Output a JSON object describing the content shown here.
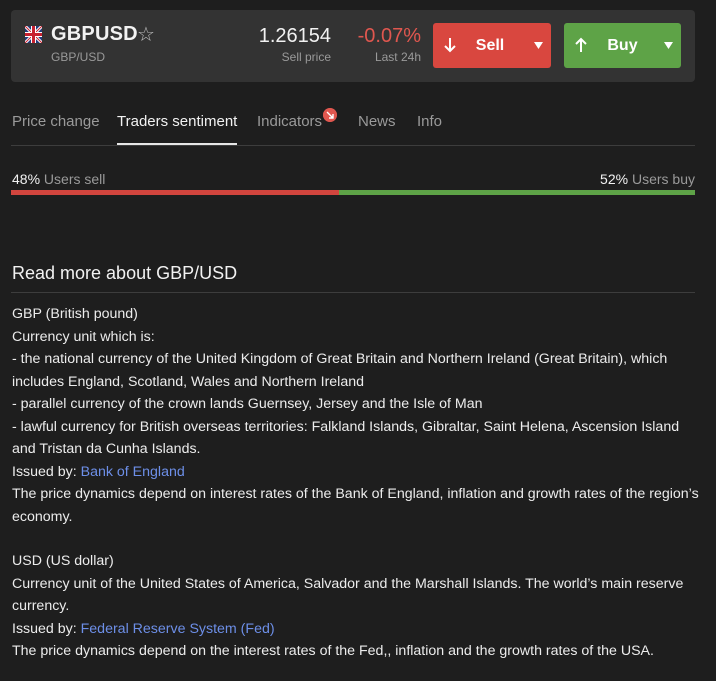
{
  "instrument": {
    "symbol": "GBPUSD",
    "pair": "GBP/USD",
    "flag_icon": "uk-flag-icon",
    "favorite_icon": "star-outline-icon"
  },
  "quote": {
    "price": "1.26154",
    "price_label": "Sell price",
    "change": "-0.07%",
    "change_label": "Last 24h"
  },
  "actions": {
    "sell_label": "Sell",
    "buy_label": "Buy"
  },
  "tabs": [
    {
      "label": "Price change",
      "active": false
    },
    {
      "label": "Traders sentiment",
      "active": true
    },
    {
      "label": "Indicators",
      "active": false,
      "badge": true
    },
    {
      "label": "News",
      "active": false
    },
    {
      "label": "Info",
      "active": false
    }
  ],
  "sentiment": {
    "sell_pct": 48,
    "buy_pct": 52,
    "sell_pct_text": "48%",
    "buy_pct_text": "52%",
    "sell_label": " Users sell",
    "buy_label": " Users buy"
  },
  "read_more": {
    "title": "Read more about GBP/USD",
    "gbp": {
      "heading": "GBP (British pound)",
      "intro": "Currency unit which is:",
      "point1": "- the national currency of the United Kingdom of Great Britain and Northern Ireland (Great Britain), which includes England, Scotland, Wales and Northern Ireland",
      "point2": "- parallel currency of the crown lands Guernsey, Jersey and the Isle of Man",
      "point3": "- lawful currency for British overseas territories: Falkland Islands, Gibraltar, Saint Helena, Ascension Island and Tristan da Cunha Islands.",
      "issued_label": "Issued by: ",
      "issuer": "Bank of England",
      "dynamics": "The price dynamics depend on interest rates of the Bank of England, inflation and growth rates of the region’s economy."
    },
    "usd": {
      "heading": "USD (US dollar)",
      "intro": "Currency unit of the United States of America, Salvador and the Marshall Islands. The world’s main reserve currency.",
      "issued_label": "Issued by: ",
      "issuer": "Federal Reserve System (Fed)",
      "dynamics": "The price dynamics depend on the interest rates of the Fed,, inflation and the growth rates of the USA."
    }
  }
}
